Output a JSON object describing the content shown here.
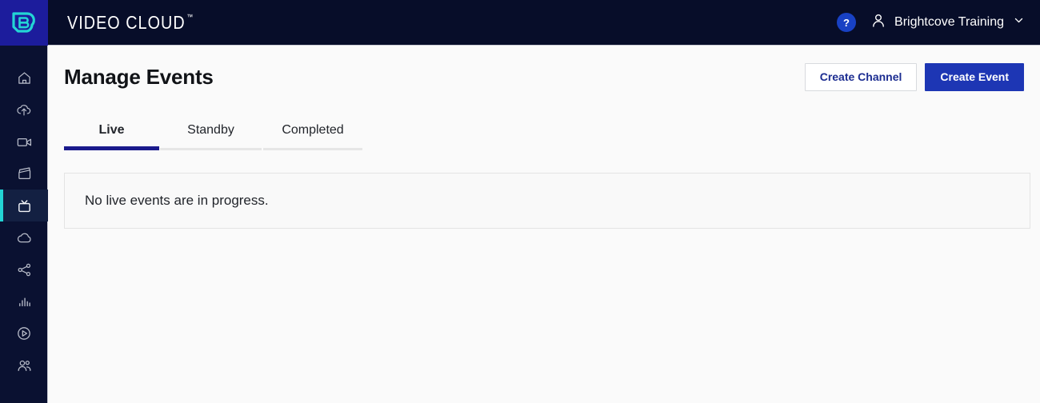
{
  "header": {
    "logo_icon": "brightcove-b-logo",
    "product_name": "VIDEO CLOUD",
    "trademark": "™",
    "help_label": "?",
    "account_name": "Brightcove Training",
    "account_icon": "person-icon",
    "chevron_icon": "chevron-down-icon"
  },
  "sidebar": {
    "items": [
      {
        "icon": "home-icon",
        "name": "home"
      },
      {
        "icon": "upload-cloud-icon",
        "name": "upload"
      },
      {
        "icon": "video-camera-icon",
        "name": "media"
      },
      {
        "icon": "clapperboard-icon",
        "name": "playlists"
      },
      {
        "icon": "tv-icon",
        "name": "live",
        "active": true
      },
      {
        "icon": "cloud-icon",
        "name": "cloud"
      },
      {
        "icon": "share-icon",
        "name": "social"
      },
      {
        "icon": "bar-chart-icon",
        "name": "analytics"
      },
      {
        "icon": "play-circle-icon",
        "name": "players"
      },
      {
        "icon": "people-icon",
        "name": "audience"
      }
    ]
  },
  "page": {
    "title": "Manage Events",
    "actions": {
      "create_channel": "Create Channel",
      "create_event": "Create Event"
    },
    "tabs": [
      {
        "label": "Live",
        "active": true
      },
      {
        "label": "Standby",
        "active": false
      },
      {
        "label": "Completed",
        "active": false
      }
    ],
    "empty_state": "No live events are in progress."
  },
  "colors": {
    "header_bg": "#070d29",
    "sidebar_bg": "#0a1131",
    "logo_tile": "#1c1c9c",
    "logo_mark": "#23d5d5",
    "accent_cyan": "#23d5d5",
    "primary_button": "#1d36b4",
    "help_blue": "#1841c4",
    "active_tab_underline": "#1a1a8c",
    "inactive_tab_underline": "#e6e6e6",
    "page_bg": "#fafafa"
  }
}
